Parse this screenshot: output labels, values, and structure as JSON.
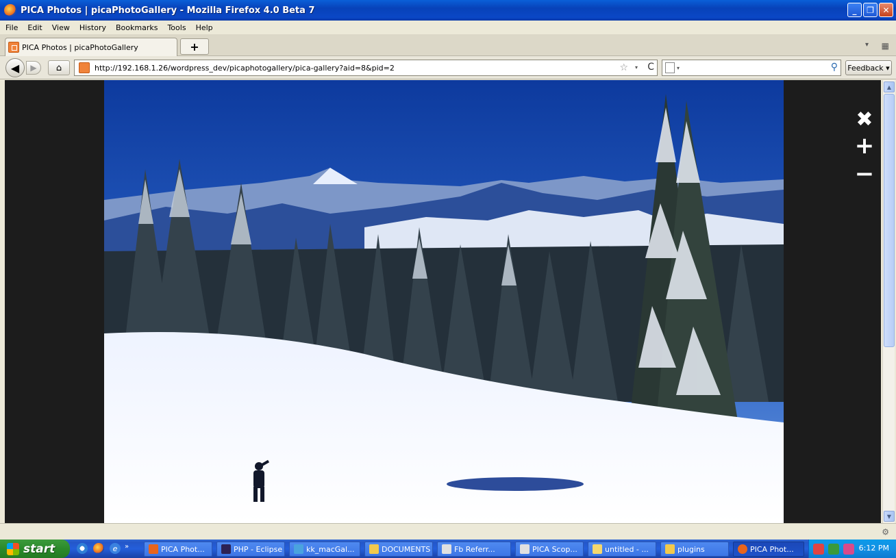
{
  "window": {
    "title": "PICA Photos | picaPhotoGallery - Mozilla Firefox 4.0 Beta 7",
    "minimize": "_",
    "restore": "❐",
    "close": "✕"
  },
  "menu": [
    "File",
    "Edit",
    "View",
    "History",
    "Bookmarks",
    "Tools",
    "Help"
  ],
  "tabs": {
    "active_label": "PICA Photos | picaPhotoGallery",
    "new_tab": "+",
    "list_arrow": "▾",
    "groups_icon": "▦"
  },
  "nav": {
    "back": "◀",
    "forward": "▶",
    "home": "⌂",
    "url": "http://192.168.1.26/wordpress_dev/picaphotogallery/pica-gallery?aid=8&pid=2",
    "star": "☆",
    "dropdown": "▾",
    "reload": "C",
    "search_dropdown": "▾",
    "search_icon": "⚲",
    "feedback": "Feedback ▾"
  },
  "lightbox": {
    "close": "✖",
    "zoom_in": "+",
    "zoom_out": "−"
  },
  "scrollbar": {
    "up": "▲",
    "down": "▼"
  },
  "status": {
    "addon": "⚙"
  },
  "taskbar": {
    "start": "start",
    "more": "»",
    "e_icon": "e",
    "tasks": [
      {
        "label": "PICA Phot...",
        "icon_color": "#e8641c"
      },
      {
        "label": "PHP - Eclipse",
        "icon_color": "#2c2255"
      },
      {
        "label": "kk_macGal...",
        "icon_color": "#4aa3df"
      },
      {
        "label": "DOCUMENTS",
        "icon_color": "#f2c94c"
      },
      {
        "label": "Fb Referr...",
        "icon_color": "#e0e0e0"
      },
      {
        "label": "PICA Scop...",
        "icon_color": "#e0e0e0"
      },
      {
        "label": "untitled - ...",
        "icon_color": "#f5d76e"
      },
      {
        "label": "plugins",
        "icon_color": "#f2c94c"
      },
      {
        "label": "PICA Phot...",
        "icon_color": "#e8641c"
      }
    ],
    "time": "6:12 PM"
  }
}
